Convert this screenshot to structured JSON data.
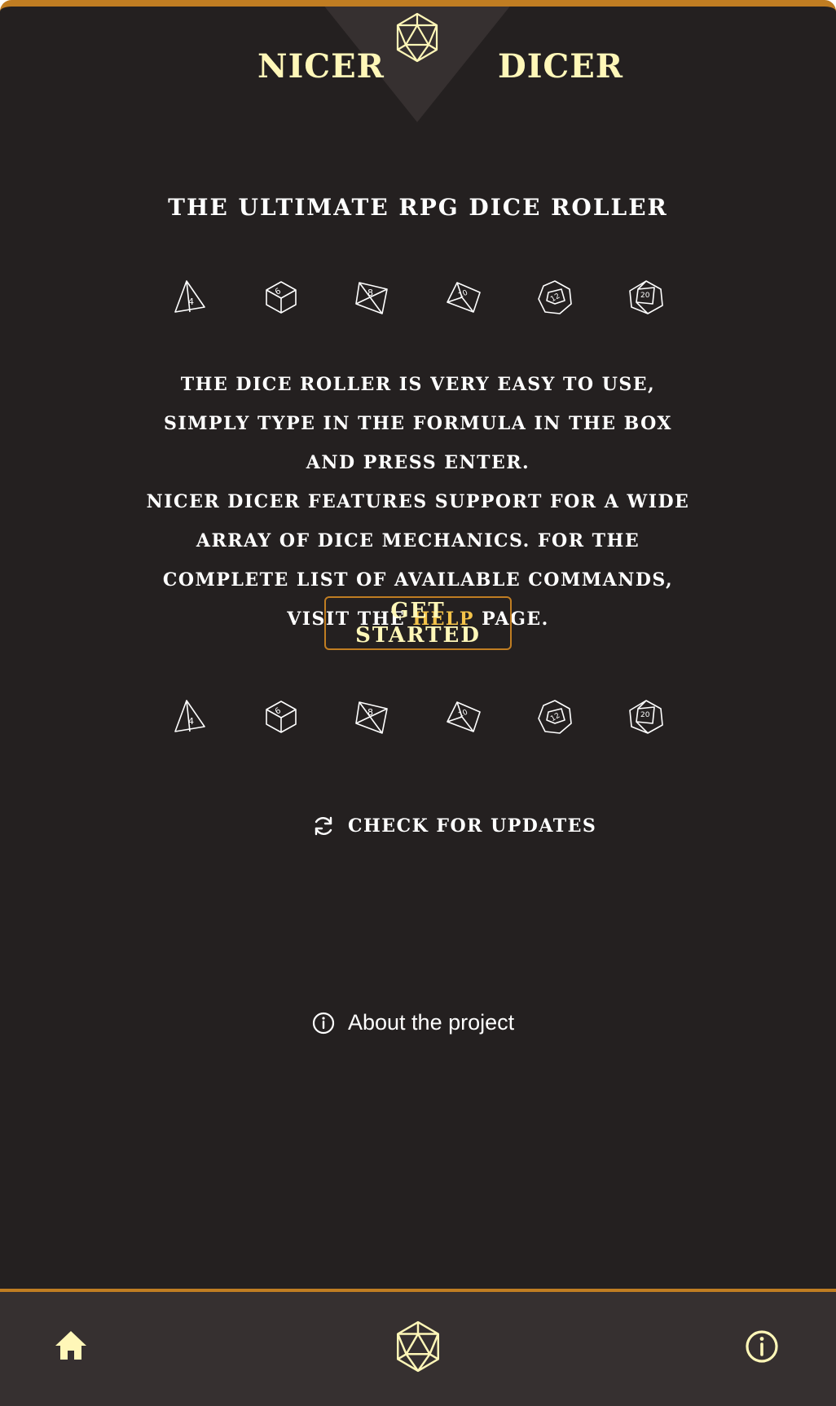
{
  "header": {
    "brand_left": "NICER",
    "brand_right": "DICER",
    "logo_icon": "d20-icon"
  },
  "tagline": "THE ULTIMATE RPG DICE ROLLER",
  "dice": [
    {
      "label": "4",
      "icon": "d4-icon"
    },
    {
      "label": "6",
      "icon": "d6-icon"
    },
    {
      "label": "8",
      "icon": "d8-icon"
    },
    {
      "label": "10",
      "icon": "d10-icon"
    },
    {
      "label": "12",
      "icon": "d12-icon"
    },
    {
      "label": "20",
      "icon": "d20-icon"
    }
  ],
  "description": {
    "line1": "The dice roller is very easy to use, simply type in the formula in the box and press enter.",
    "line2_before": "Nicer Dicer features support for a wide array of dice mechanics. For the complete list of available commands, visit the ",
    "help_link": "HELP",
    "line2_after": " page."
  },
  "cta": {
    "label": "GET STARTED"
  },
  "updates": {
    "label": "CHECK FOR UPDATES",
    "icon": "refresh-icon"
  },
  "about": {
    "label": "About the project",
    "icon": "info-icon"
  },
  "bottom_nav": {
    "home_icon": "home-icon",
    "dice_icon": "d20-icon",
    "info_icon": "info-icon"
  },
  "colors": {
    "background": "#242020",
    "accent": "#c07d22",
    "brand_text": "#fff7b8",
    "link": "#f4c34a",
    "nav_background": "#363030"
  }
}
